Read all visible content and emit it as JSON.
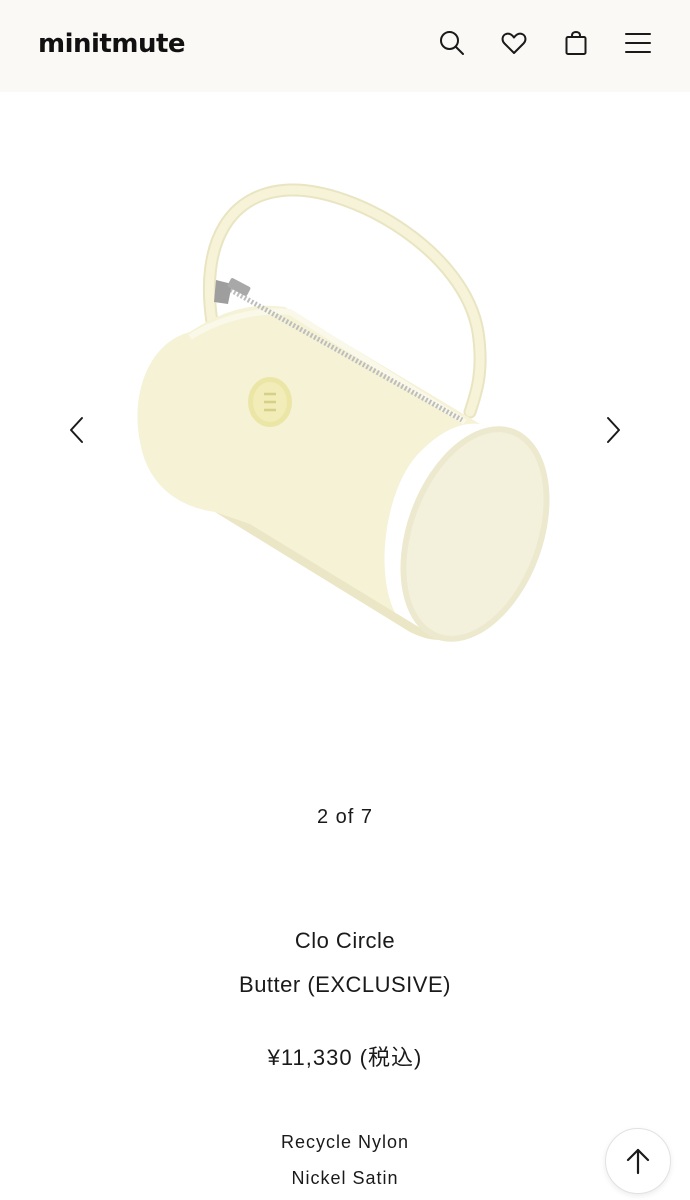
{
  "header": {
    "logo": "minitmute",
    "icons": [
      "search-icon",
      "heart-icon",
      "shopping-bag-icon",
      "hamburger-menu-icon"
    ]
  },
  "gallery": {
    "counter": "2 of 7",
    "current": 2,
    "total": 7,
    "colors": {
      "bag": "#f4f1d3",
      "bag_shade": "#e7e3bd",
      "hardware": "#b9b9b9"
    }
  },
  "product": {
    "name": "Clo Circle",
    "variant": "Butter (EXCLUSIVE)",
    "price": "¥11,330 (税込)",
    "materials": [
      "Recycle Nylon",
      "Nickel Satin"
    ]
  },
  "colors": {
    "header_bg": "#fbf9f5",
    "text": "#1a1a1a"
  },
  "scroll_top_icon": "arrow-up-icon"
}
